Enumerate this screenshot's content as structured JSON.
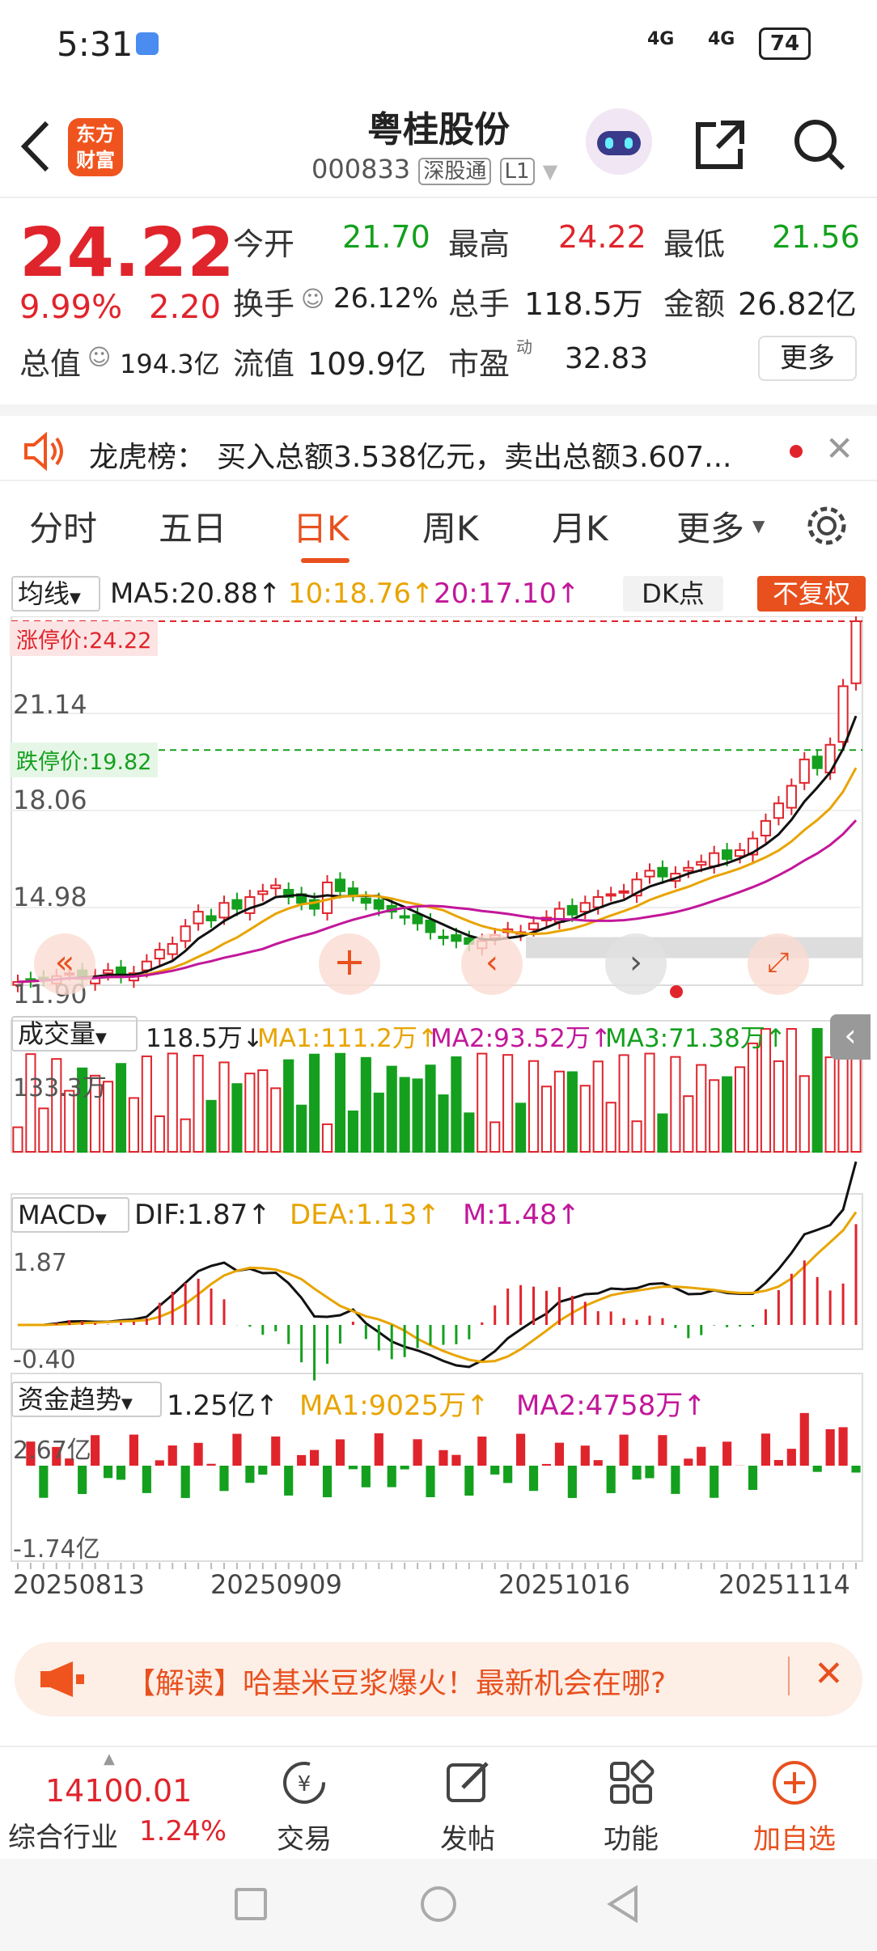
{
  "status_bar": {
    "time": "5:31",
    "net1": "4G",
    "net2": "4G",
    "battery": "74"
  },
  "header": {
    "title": "粤桂股份",
    "code": "000833",
    "exchange_tag": "深股通",
    "level_tag": "L1",
    "logo_line1": "东方",
    "logo_line2": "财富"
  },
  "quote": {
    "price": "24.22",
    "change_pct": "9.99%",
    "change": "2.20",
    "open_label": "今开",
    "open": "21.70",
    "high_label": "最高",
    "high": "24.22",
    "low_label": "最低",
    "low": "21.56",
    "turnover_label": "换手",
    "turnover": "26.12%",
    "volume_label": "总手",
    "volume": "118.5万",
    "amount_label": "金额",
    "amount": "26.82亿",
    "mktcap_label": "总值",
    "mktcap": "194.3亿",
    "float_label": "流值",
    "float": "109.9亿",
    "pe_label": "市盈",
    "pe_sup": "动",
    "pe": "32.83",
    "more": "更多"
  },
  "notice": {
    "prefix": "龙虎榜：",
    "text": "买入总额3.538亿元，卖出总额3.607..."
  },
  "tabs": [
    {
      "label": "分时"
    },
    {
      "label": "五日"
    },
    {
      "label": "日K"
    },
    {
      "label": "周K"
    },
    {
      "label": "月K"
    },
    {
      "label": "更多"
    }
  ],
  "chart": {
    "ma_selector": "均线",
    "ma5": "MA5:20.88↑",
    "ma10": "10:18.76↑",
    "ma20": "20:17.10↑",
    "dk": "DK点",
    "fq": "不复权",
    "limit_up": "涨停价:24.22",
    "limit_down": "跌停价:19.82",
    "price_ticks": [
      "21.14",
      "18.06",
      "14.98",
      "11.90"
    ],
    "vol_selector": "成交量",
    "vol": "118.5万↓",
    "vol_ma1": "MA1:111.2万↑",
    "vol_ma2": "MA2:93.52万↑",
    "vol_ma3": "MA3:71.38万↑",
    "vol_tick": "133.3万",
    "macd_selector": "MACD",
    "dif": "DIF:1.87↑",
    "dea": "DEA:1.13↑",
    "m": "M:1.48↑",
    "macd_top": "1.87",
    "macd_bot": "-0.40",
    "fund_selector": "资金趋势",
    "fund": "1.25亿↑",
    "fund_ma1": "MA1:9025万↑",
    "fund_ma2": "MA2:4758万↑",
    "fund_top": "2.67亿",
    "fund_bot": "-1.74亿",
    "dates": [
      "20250813",
      "20250909",
      "20251016",
      "20251114"
    ],
    "colors": {
      "up": "#e0242c",
      "down": "#14a01e",
      "ma5": "#111111",
      "ma10": "#e8a400",
      "ma20": "#c2179a"
    }
  },
  "chart_data": {
    "type": "candlestick",
    "closes": [
      11.9,
      11.95,
      12.0,
      12.1,
      12.2,
      12.0,
      12.1,
      12.3,
      12.1,
      12.2,
      12.6,
      13.0,
      13.2,
      13.8,
      14.3,
      14.0,
      14.6,
      14.4,
      14.8,
      15.0,
      15.2,
      14.8,
      14.6,
      14.4,
      15.3,
      15.0,
      14.9,
      14.6,
      14.4,
      14.3,
      14.1,
      13.9,
      13.6,
      13.4,
      13.3,
      13.2,
      13.3,
      13.5,
      13.7,
      13.6,
      13.9,
      14.1,
      14.4,
      14.2,
      14.6,
      14.8,
      14.9,
      15.0,
      15.4,
      15.7,
      15.5,
      15.6,
      15.8,
      16.0,
      16.3,
      16.1,
      16.4,
      16.8,
      17.4,
      18.0,
      18.6,
      19.5,
      19.2,
      20.0,
      22.0,
      24.22
    ],
    "ma5_last": 20.88,
    "ma10_last": 18.76,
    "ma20_last": 17.1,
    "ylim": [
      11.9,
      24.22
    ]
  },
  "banner": {
    "text": "【解读】哈基米豆浆爆火！最新机会在哪?"
  },
  "bottom": {
    "index_value": "14100.01",
    "index_name": "综合行业",
    "index_pct": "1.24%",
    "items": [
      {
        "label": "交易"
      },
      {
        "label": "发帖"
      },
      {
        "label": "功能"
      },
      {
        "label": "加自选"
      }
    ]
  }
}
